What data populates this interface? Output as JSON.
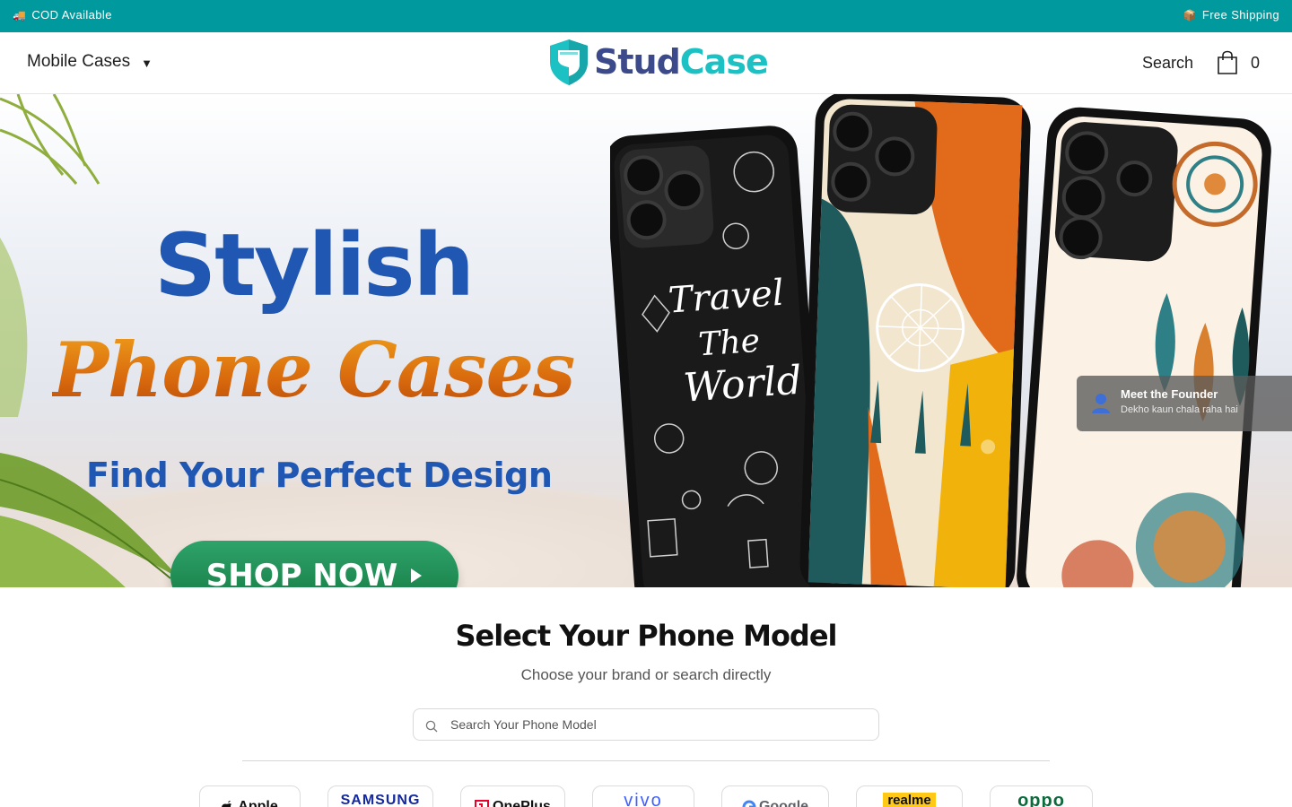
{
  "announcement": {
    "left_text": "COD Available",
    "left_emoji": "🚚",
    "right_text": "Free Shipping",
    "right_emoji": "📦"
  },
  "header": {
    "menu_label": "Mobile Cases",
    "logo_part1": "Stud",
    "logo_part2": "Case",
    "search_label": "Search",
    "cart_count": "0"
  },
  "hero": {
    "headline": "Stylish",
    "headline2": "Phone Cases",
    "tagline": "Find Your Perfect Design",
    "cta_label": "SHOP NOW",
    "phone_text1": "Travel",
    "phone_text2": "The",
    "phone_text3": "World"
  },
  "founder_widget": {
    "title": "Meet the Founder",
    "subtitle": "Dekho kaun chala raha hai"
  },
  "phone_selector": {
    "title": "Select Your Phone Model",
    "subtitle": "Choose your brand or search directly",
    "search_placeholder": "Search Your Phone Model",
    "brands": [
      {
        "label": "Apple"
      },
      {
        "label": "SAMSUNG"
      },
      {
        "label": "OnePlus"
      },
      {
        "label": "vivo"
      },
      {
        "label": "Google"
      },
      {
        "label": "realme"
      },
      {
        "label": "oppo"
      }
    ]
  },
  "colors": {
    "brand_teal": "#009a9e",
    "logo_navy": "#3c4a8c",
    "logo_teal": "#1cc1c4",
    "hero_blue": "#1f57b3",
    "hero_orange": "#d4620f",
    "cta_green": "#1f8a52"
  }
}
